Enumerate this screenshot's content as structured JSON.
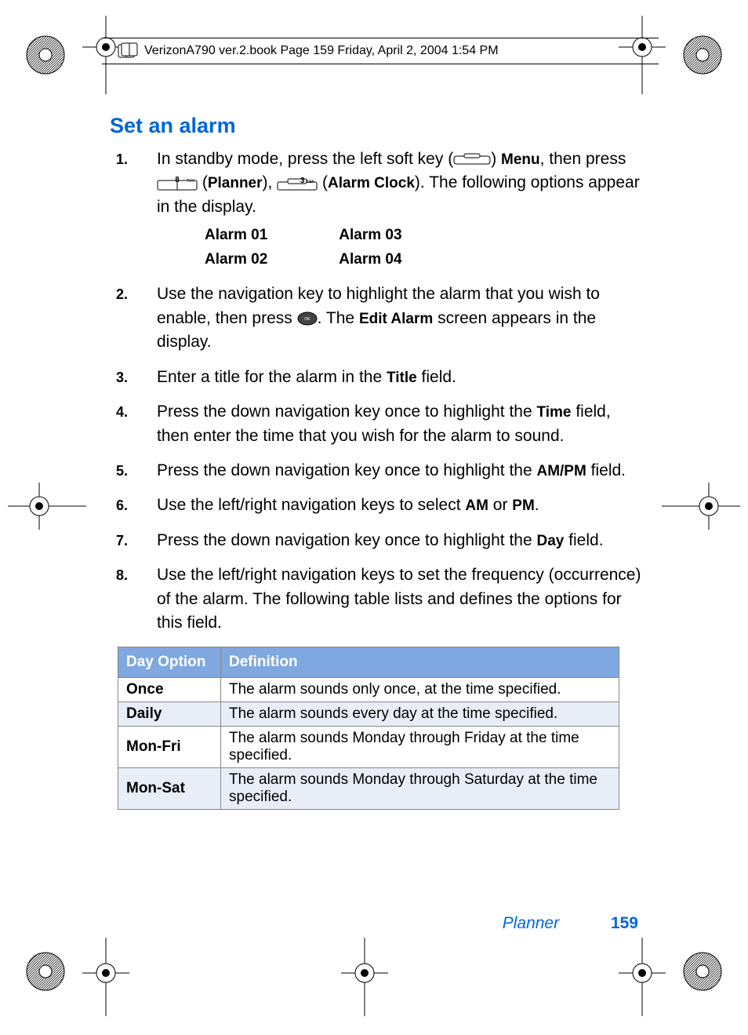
{
  "header": "VerizonA790 ver.2.book  Page 159  Friday, April 2, 2004  1:54 PM",
  "heading": "Set an alarm",
  "step1": {
    "pre": "In standby mode, press the left soft key (",
    "menu": "Menu",
    "mid1": ", then press ",
    "key8": "8",
    "key8sub": "TUV",
    "planner": "Planner",
    "mid2": "), ",
    "key3": "3",
    "key3sub": "DEF",
    "alarmclock": "Alarm Clock",
    "tail": "). The following options appear in the display."
  },
  "alarms": {
    "a1": "Alarm 01",
    "a2": "Alarm 02",
    "a3": "Alarm 03",
    "a4": "Alarm 04"
  },
  "step2": {
    "pre": "Use the navigation key to highlight the alarm that you wish to enable, then press ",
    "mid": ". The ",
    "editalarm": "Edit Alarm",
    "tail": " screen appears in the display."
  },
  "step3": {
    "pre": "Enter a title for the alarm in the ",
    "title": "Title",
    "tail": " field."
  },
  "step4": {
    "pre": "Press the down navigation key once to highlight the ",
    "time": "Time",
    "tail": " field, then enter the time that you wish for the alarm to sound."
  },
  "step5": {
    "pre": "Press the down navigation key once to highlight the ",
    "ampm": "AM/PM",
    "tail": " field."
  },
  "step6": {
    "pre": "Use the left/right navigation keys to select ",
    "am": "AM",
    "or": " or ",
    "pm": "PM",
    "tail": "."
  },
  "step7": {
    "pre": "Press the down navigation key once to highlight the ",
    "day": "Day",
    "tail": " field."
  },
  "step8": "Use the left/right navigation keys to set the frequency (occurrence) of the alarm. The following table lists and defines the options for this field.",
  "table": {
    "h1": "Day Option",
    "h2": "Definition",
    "rows": [
      {
        "opt": "Once",
        "def": "The alarm sounds only once, at the time specified."
      },
      {
        "opt": "Daily",
        "def": "The alarm sounds every day at the time specified."
      },
      {
        "opt": "Mon-Fri",
        "def": "The alarm sounds Monday through Friday at the time specified."
      },
      {
        "opt": "Mon-Sat",
        "def": "The alarm sounds Monday through Saturday at the time specified."
      }
    ]
  },
  "footer": {
    "section": "Planner",
    "page": "159"
  }
}
